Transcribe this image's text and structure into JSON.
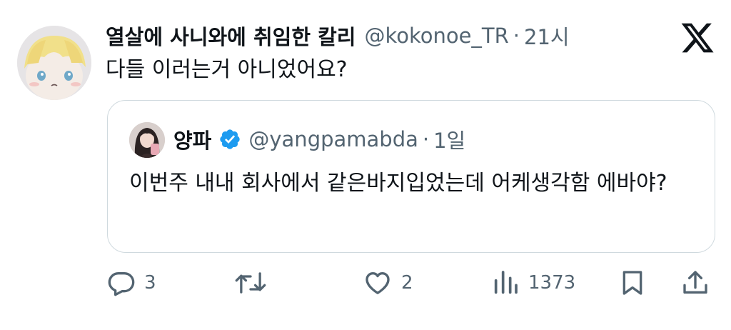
{
  "tweet": {
    "display_name": "열살에 사니와에 취임한 칼리",
    "handle": "@kokonoe_TR",
    "separator": "·",
    "time": "21시",
    "text": "다들 이러는거 아니었어요?"
  },
  "quote": {
    "display_name": "양파",
    "handle": "@yangpamabda",
    "separator": "·",
    "time": "1일",
    "text": "이번주 내내 회사에서 같은바지입었는데 어케생각함 에바야?"
  },
  "actions": {
    "replies": "3",
    "retweets": "",
    "likes": "2",
    "views": "1373"
  },
  "colors": {
    "text": "#0f1419",
    "secondary": "#536471",
    "border": "#cfd9de",
    "verified": "#1d9bf0"
  },
  "icons": [
    "x-logo-icon",
    "verified-badge-icon",
    "reply-icon",
    "retweet-icon",
    "like-icon",
    "views-icon",
    "bookmark-icon",
    "share-icon"
  ]
}
